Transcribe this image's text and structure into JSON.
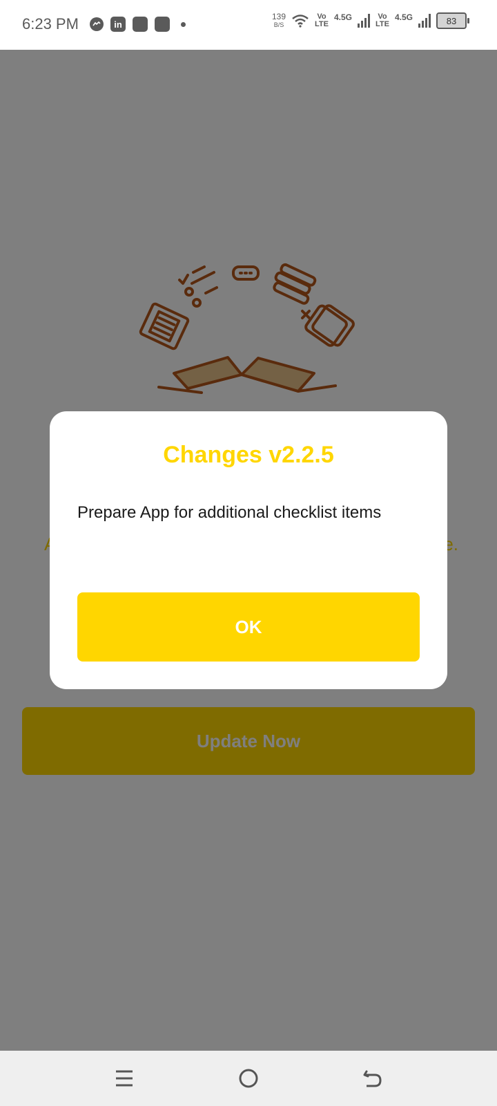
{
  "status_bar": {
    "time": "6:23 PM",
    "speed_value": "139",
    "speed_unit": "B/S",
    "volte_1_top": "Vo",
    "volte_1_bottom": "LTE",
    "network_1": "4.5G",
    "volte_2_top": "Vo",
    "volte_2_bottom": "LTE",
    "network_2": "4.5G",
    "battery": "83",
    "notification_icons": [
      "messenger-icon",
      "linkedin-icon",
      "app-icon",
      "app-icon"
    ]
  },
  "background": {
    "partial_text_left": "A",
    "partial_text_right": "e.",
    "update_button_label": "Update Now"
  },
  "dialog": {
    "title": "Changes v2.2.5",
    "message": "Prepare App for additional checklist items",
    "ok_label": "OK"
  },
  "colors": {
    "accent": "#FFD600",
    "illustration": "#B5561A"
  },
  "nav_bar": {
    "icons": [
      "menu-icon",
      "home-icon",
      "back-icon"
    ]
  }
}
